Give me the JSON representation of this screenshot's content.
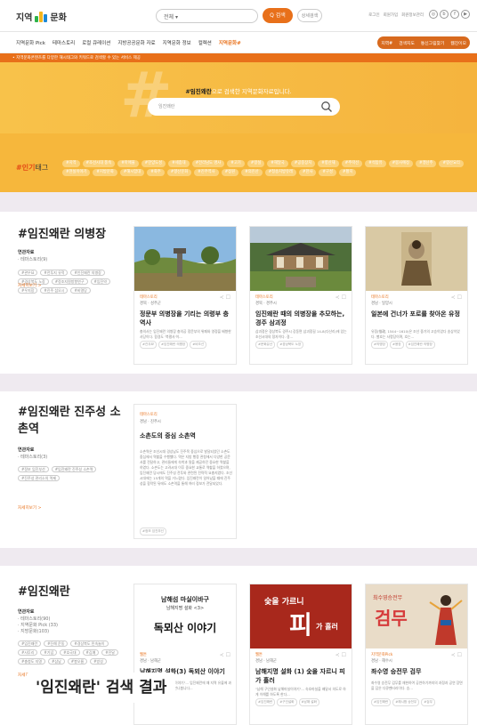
{
  "header": {
    "logo_text_1": "지역",
    "logo_text_2": "문화",
    "search_select": "전체",
    "search_button": "Q 검색",
    "detail_button": "상세검색",
    "util_links": [
      "로그인",
      "회원가입",
      "회원정보관리"
    ],
    "social_icons": [
      "instagram-icon",
      "blog-icon",
      "facebook-icon",
      "youtube-icon"
    ]
  },
  "nav": {
    "items": [
      "지역문화 Pick",
      "테마스토리",
      "로컬 큐레이션",
      "지방공공문화 자료",
      "지역문화 정보",
      "컬렉션",
      "지역문화#"
    ],
    "right_items": [
      "지역#",
      "검색지도",
      "통신그림찾기",
      "웹진이모"
    ]
  },
  "notice": "• 지역문화콘텐츠를 다양한 해시태그와 키워드로 검색할 수 있는 서비스 제공",
  "hero": {
    "deco": "#",
    "title_bold": "#임진왜란",
    "title_orange": "으로 검색한 지역문화자료입니다.",
    "input_value": "임진왜란"
  },
  "popular": {
    "label_hash": "#인기",
    "label_text": "태그",
    "tags": [
      "#지역",
      "#조선시대 풍속",
      "#마애불",
      "#한양도성",
      "#세종대",
      "#전라남도 명사",
      "#고기",
      "#왕실",
      "#해달국",
      "#공중장치",
      "#향산재",
      "#추락선",
      "#석탑유",
      "#봉사예정",
      "#맹산주",
      "#향산요리",
      "#현실이야기",
      "#지방문화",
      "#해시함대",
      "#화주",
      "#향산문화",
      "#진주역사",
      "#정원",
      "#의진산",
      "#청송지방유래",
      "#한사",
      "#구성",
      "#황지"
    ]
  },
  "section1": {
    "title": "#임진왜란 의병장",
    "rel_heading": "연관자료",
    "rel_count": "· 테마스토리(9)",
    "tags": [
      "#관우묘",
      "#전투지 유적",
      "#인진왜란 의병장",
      "#경상북도 노장",
      "#정조지원방항연구",
      "#임진약",
      "#우지장",
      "#진주 섬오시",
      "#비명당"
    ],
    "more": "자세히보기 >",
    "cards": [
      {
        "badge": "테마스토리",
        "loc": "경북 · 성주군",
        "title": "정문부 의병장을 기리는 의령부 충역사",
        "desc": "충의사는 임진왜란 의병장 충의공 정문부의 위패와 영정을 배향한 사당이다. 함경도 '북평사'이...",
        "tags": [
          "#관우묘",
          "#임진왜란 의병장",
          "#비조선"
        ]
      },
      {
        "badge": "테마스토리",
        "loc": "경북 · 경주시",
        "title": "임진왜란 때의 의병장을 추모하는, 경주 삼괴정",
        "desc": "삼괴정은 경상북도 경주시 강동면 삼괴정길 14-8(다산리)에 있는 조선시대의 정자이다. 경...",
        "tags": [
          "#문화유산",
          "#경상북도 노장"
        ]
      },
      {
        "badge": "테마스토리",
        "loc": "경남 · 일양시",
        "title": "일본에 건너가 포로를 찾아온 유정",
        "desc": "유정(惟政, 1544~1610)은 조선 중기의 고승이었다 송상이었다. 별호는 사명당이며, 호는...",
        "tags": [
          "#의병장",
          "#용장",
          "#임진왜란 의병장"
        ]
      }
    ]
  },
  "section2": {
    "title": "#임진왜란 진주성 소촌역",
    "rel_heading": "연관자료",
    "rel_count": "· 테마스토리(3)",
    "tags": [
      "#정보 임진부선",
      "#임진왜란 진주성 소촌역",
      "#진주성 관리소의 역제"
    ],
    "more": "자세히보기 >",
    "card": {
      "badge": "테마스토리",
      "loc": "경남 · 진주시",
      "title": "소촌도의 중심 소촌역",
      "desc": "소촌역은 조선시대 경상남도 진주목 중심으로 발달되었던 소촌도 중심에서 역할을 수행했다. 역은 지방 행정 관청에서 다양한 공문서를 전달하고, 관리들에게 숙박과 말을 제공하던 중요한 역할을 하였다. 소촌도는 고려시대 이후 중요한 교통로 역할을 하였으며, 임진왜란 당시에도 진주성 전투와 관련된 전략적 요충지였다. 조선시대에는 15개의 역을 거느렸다. 임진왜란이 일어났을 때에 진주성을 함락된 뒤에도 소촌역을 통해 여러 정보가 전달되었다.",
      "tags": [
        "#정보 임진부선"
      ]
    }
  },
  "section3": {
    "title": "#임진왜란",
    "rel_heading": "연관자료",
    "rel_count": [
      "· 테마스토리(90)",
      "· 지역문화 Pick (33)",
      "· 지방문화(103)"
    ],
    "tags": [
      "#임진왜란",
      "#진해 운동",
      "#경상북도 민속놀이",
      "#사투리",
      "#기념",
      "#호국대",
      "#김예",
      "#진달",
      "#충청도 지명",
      "#삼남",
      "#봉오름",
      "#방성"
    ],
    "more": "자세히보기 >",
    "cards": [
      {
        "img_top": "남해섬 마실이바구",
        "img_sub": "남해지명 설화 <3>",
        "img_title": "독뫼산 이야기",
        "badge": "웹툰",
        "loc": "경남 · 남해군",
        "title": "남해지명 설화(3) 독뫼산 이야기",
        "desc": "\"나무 구리대왕 남해마설이야기\"... 임진왜란에 때 지역 유물에 과시된 독뫼산의 이야기를 만나봅니다...",
        "tags": [
          "#임진왜란"
        ]
      },
      {
        "img_top": "숯을 가르니",
        "img_big": "피",
        "img_sub2": "가 흘러",
        "badge": "웹툰",
        "loc": "경남 · 남해군",
        "title": "남해지명 설화 (1) 숯을 자르니 피가 흘러",
        "desc": "\"남해 구인설화 남해마실이야기\"... 숙호마실을 배달서 의도로 하게 이해를 하도록 한다...",
        "tags": [
          "#임진왜란",
          "#구인설화",
          "#남해 설화"
        ]
      },
      {
        "img_top": "최수영승전무",
        "img_title": "검무",
        "badge": "지역문화Pick",
        "loc": "경남 · 해수시",
        "title": "좌수영 승전무 검무",
        "desc": "좌수영 승전무 검무를 재현하여 공연하기까지의 과정과 공연 장면을 담은 다큐멘터리이다. 승...",
        "tags": [
          "#임진왜란",
          "#해시함 승전무",
          "#검무"
        ]
      }
    ]
  },
  "caption": "'임진왜란' 검색 결과"
}
